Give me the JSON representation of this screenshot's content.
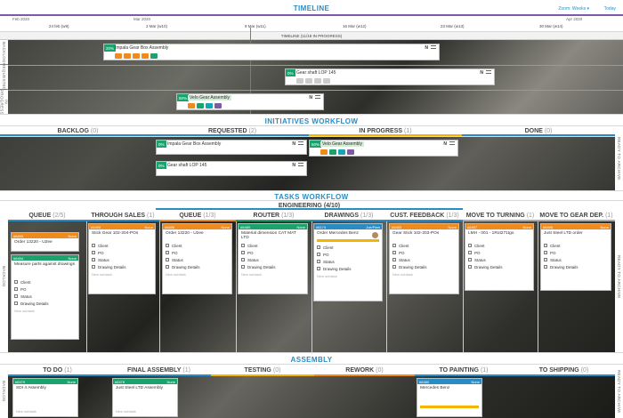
{
  "timeline": {
    "title": "TIMELINE",
    "zoom": "Zoom: Weeks ▾",
    "today": "Today",
    "months": [
      "Feb 2020",
      "Mar 2020",
      "Apr 2020"
    ],
    "weeks": [
      "24 feb (w9)",
      "2 Mar (w10)",
      "9 Mar (w11)",
      "16 Mar (w12)",
      "23 Mar (w13)",
      "30 Mar (w14)"
    ],
    "subtitle": "TIMELINE (11/18 IN PROGRESS)",
    "lanes": [
      "BACKLOG",
      "REQUESTED",
      "IN PROGRESS"
    ],
    "cards": [
      {
        "pct": "20%",
        "name": "Impala Gear Box Assembly",
        "n": "N"
      },
      {
        "pct": "0%",
        "name": "Gear shaft LOP 145",
        "n": "N"
      },
      {
        "pct": "50%",
        "name": "Velo Gear Assembly",
        "n": "N"
      }
    ]
  },
  "initiatives": {
    "title": "INITIATIVES WORKFLOW",
    "columns": [
      {
        "label": "BACKLOG",
        "count": "(0)"
      },
      {
        "label": "REQUESTED",
        "count": "(2)"
      },
      {
        "label": "IN PROGRESS",
        "count": "(1)"
      },
      {
        "label": "DONE",
        "count": "(0)"
      }
    ],
    "cards": [
      {
        "pct": "0%",
        "name": "Impala Gear Box Assembly",
        "n": "N"
      },
      {
        "pct": "0%",
        "name": "Gear shaft LOP 145",
        "n": "N"
      },
      {
        "pct": "50%",
        "name": "Velo Gear Assembly",
        "n": "N"
      }
    ],
    "right_lane": "READY TO ARCHIVE"
  },
  "tasks": {
    "title": "TASKS WORKFLOW",
    "group": "ENGINEERING (4/10)",
    "columns": [
      {
        "label": "QUEUE",
        "count": "(2/5)"
      },
      {
        "label": "THROUGH SALES",
        "count": "(1)"
      },
      {
        "label": "QUEUE",
        "count": "(1/3)"
      },
      {
        "label": "ROUTER",
        "count": "(1/3)"
      },
      {
        "label": "DRAWINGS",
        "count": "(1/3)"
      },
      {
        "label": "CUST. FEEDBACK",
        "count": "(1/3)"
      },
      {
        "label": "MOVE TO TURNING",
        "count": "(1)"
      },
      {
        "label": "MOVE TO GEAR DEP.",
        "count": "(1)"
      }
    ],
    "left_lane": "BACKLOG",
    "right_lane": "READY TO ARCHIVE",
    "checklist": [
      "Client",
      "PO",
      "Status",
      "Drawing Details"
    ],
    "add": "New subtask",
    "cards": [
      {
        "id": "#6490",
        "owner": "None",
        "title": "Order 13220 - U2ee",
        "checklist": false
      },
      {
        "id": "#6494",
        "owner": "None",
        "title": "Measure parts against drawings",
        "checklist": true
      },
      {
        "id": "#6495",
        "owner": "None",
        "title": "Stick Gear 102-204-POs",
        "checklist": true
      },
      {
        "id": "#6496",
        "owner": "None",
        "title": "Order 13220 - U2ee",
        "checklist": true
      },
      {
        "id": "#6489",
        "owner": "None",
        "title": "Material dimension CAT MAT LTD",
        "checklist": true
      },
      {
        "id": "#6174",
        "owner": "Joe/Pam",
        "title": "Order Mercedes Benz",
        "checklist": true
      },
      {
        "id": "#6483",
        "owner": "None",
        "title": "Gear Stick 102-203-POs",
        "checklist": true
      },
      {
        "id": "#6497",
        "owner": "None",
        "title": "LMH - 001 - 1Rot271tgo",
        "checklist": true
      },
      {
        "id": "#6498",
        "owner": "None",
        "title": "Just Steel LTD order",
        "checklist": true
      }
    ]
  },
  "assembly": {
    "title": "ASSEMBLY",
    "columns": [
      {
        "label": "TO DO",
        "count": "(1)"
      },
      {
        "label": "FINAL ASSEMBLY",
        "count": "(1)"
      },
      {
        "label": "TESTING",
        "count": "(0)"
      },
      {
        "label": "REWORK",
        "count": "(0)"
      },
      {
        "label": "TO PAINTING",
        "count": "(1)"
      },
      {
        "label": "TO SHIPPING",
        "count": "(0)"
      }
    ],
    "left_lane": "BACKLOG",
    "right_lane": "READY TO ARCHIVE",
    "cards": [
      {
        "id": "#6479",
        "owner": "None",
        "title": "SDI 4 Assembly"
      },
      {
        "id": "#6478",
        "owner": "None",
        "title": "Just Steel LTD Assembly"
      },
      {
        "id": "#6480",
        "owner": "None",
        "title": "Mercedes Benz"
      }
    ],
    "add": "New subtask"
  },
  "colors": {
    "accent": "#2b8cc4",
    "green": "#1aa36d",
    "orange": "#f08a1c",
    "teal": "#18a4b7",
    "purple": "#7c5aa6",
    "yellow": "#f4b400"
  }
}
